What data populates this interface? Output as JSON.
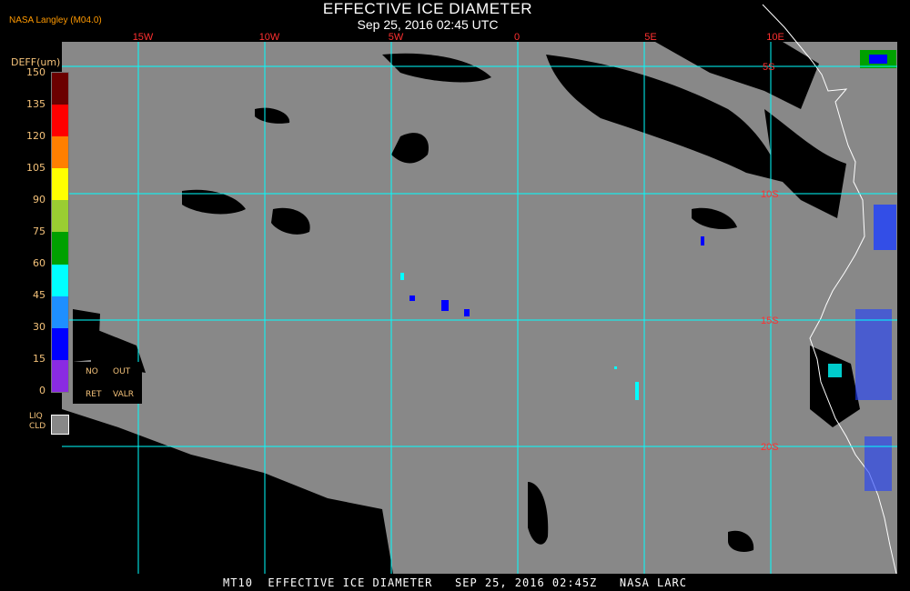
{
  "header": {
    "title": "EFFECTIVE ICE DIAMETER",
    "subtitle": "Sep 25, 2016 02:45 UTC",
    "credit": "NASA Langley (M04.0)"
  },
  "footer": {
    "text": "MT10  EFFECTIVE ICE DIAMETER   SEP 25, 2016 02:45Z   NASA LARC"
  },
  "legend": {
    "units_label": "DEFF(um)",
    "ticks": [
      "150",
      "135",
      "120",
      "105",
      "90",
      "75",
      "60",
      "45",
      "30",
      "15",
      "0"
    ],
    "colors": [
      "#6b0000",
      "#ff0000",
      "#ff7f00",
      "#ffff00",
      "#9acd32",
      "#00a000",
      "#00ffff",
      "#1e8fff",
      "#0000ff",
      "#8a2be2"
    ],
    "no_ret_labels": [
      "NO",
      "OUT",
      "RET",
      "VALR"
    ],
    "liq_label_1": "LIQ",
    "liq_label_2": "CLD",
    "liq_color": "#888888"
  },
  "map": {
    "background_color": "#888888",
    "grid_color": "#00ffff",
    "coastline_color": "#ffffff",
    "lon_labels": [
      "15W",
      "10W",
      "5W",
      "0",
      "5E",
      "10E"
    ],
    "lat_labels": [
      "5S",
      "10S",
      "15S",
      "20S"
    ],
    "label_color": "#ff3030"
  }
}
